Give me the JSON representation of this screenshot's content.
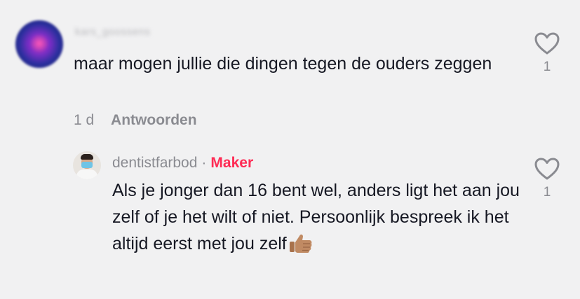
{
  "comment": {
    "username": "kars_goossens",
    "text": "maar mogen jullie die dingen tegen de ouders zeggen",
    "time": "1 d",
    "reply_label": "Antwoorden",
    "like_count": "1"
  },
  "reply": {
    "username": "dentistfarbod",
    "separator": "·",
    "badge": "Maker",
    "text": "Als je jonger dan 16 bent wel, anders ligt het aan jou zelf of je het wilt of niet. Persoonlijk bespreek ik het altijd eerst met jou zelf",
    "emoji": "thumbs-up-icon",
    "like_count": "1"
  },
  "colors": {
    "background": "#f1f1f2",
    "text": "#161823",
    "muted": "#8a8b91",
    "accent": "#fe2c55"
  }
}
